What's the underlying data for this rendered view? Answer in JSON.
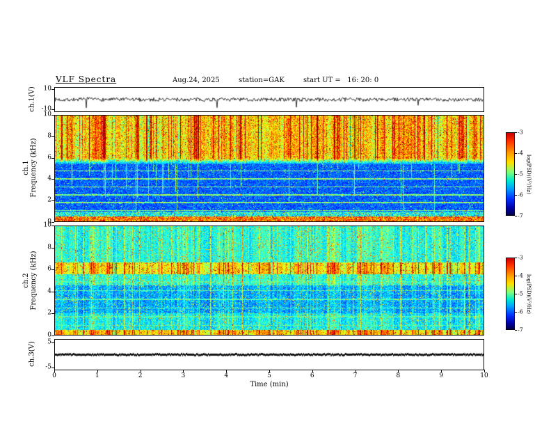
{
  "header": {
    "title": "VLF Spectra",
    "date": "Aug.24, 2025",
    "station": "station=GAK",
    "start_ut": "start UT =   16: 20: 0"
  },
  "xaxis": {
    "label": "Time (min)",
    "ticks": [
      "0",
      "1",
      "2",
      "3",
      "4",
      "5",
      "6",
      "7",
      "8",
      "9",
      "10"
    ],
    "range": [
      0,
      10
    ]
  },
  "panels": {
    "wave1": {
      "ylabel": "ch.1(V)",
      "yticks": [
        "10",
        "-10"
      ],
      "ylim": [
        -10,
        10
      ]
    },
    "spec1": {
      "channel": "ch.1",
      "ylabel": "Frequency (kHz)",
      "yticks": [
        "10",
        "8",
        "6",
        "4",
        "2",
        "0"
      ],
      "ylim": [
        0,
        10
      ]
    },
    "spec2": {
      "channel": "ch.2",
      "ylabel": "Frequency (kHz)",
      "yticks": [
        "10",
        "8",
        "6",
        "4",
        "2",
        "0"
      ],
      "ylim": [
        0,
        10
      ]
    },
    "wave3": {
      "ylabel": "ch.3(V)",
      "yticks": [
        "5",
        "-5"
      ],
      "ylim": [
        -5,
        5
      ]
    }
  },
  "colorbar": {
    "label": "log(PSD)(V²/Hz)",
    "ticks": [
      "-3",
      "-4",
      "-5",
      "-6",
      "-7"
    ],
    "scale_range": [
      -7,
      -3
    ]
  },
  "chart_data": [
    {
      "type": "line",
      "name": "ch.1(V) time series",
      "xlabel": "Time (min)",
      "xlim": [
        0,
        10
      ],
      "ylabel": "ch.1(V)",
      "ylim": [
        -10,
        10
      ],
      "description": "Broadband receiver output fluctuating around 0 V (roughly ±2 V) with intermittent impulsive spikes reaching about ±8 V throughout the 10-minute record."
    },
    {
      "type": "heatmap",
      "name": "ch.1 spectrogram",
      "xlabel": "Time (min)",
      "xlim": [
        0,
        10
      ],
      "ylabel": "Frequency (kHz)",
      "ylim": [
        0,
        10
      ],
      "colorbar_label": "log(PSD)(V²/Hz)",
      "color_scale": [
        -7,
        -3
      ],
      "colormap": "jet",
      "description": "Dense vertical impulsive striations (sferics) strongest above ~6 kHz (green/yellow/red, log PSD ≈ -4 to -3); 0.5–5.5 kHz mostly dark blue background (≈ -6.5 to -7) crossed by thin cyan horizontal tone lines and occasional full-height streaks; bright red-orange band below ~0.5 kHz."
    },
    {
      "type": "heatmap",
      "name": "ch.2 spectrogram",
      "xlabel": "Time (min)",
      "xlim": [
        0,
        10
      ],
      "ylabel": "Frequency (kHz)",
      "ylim": [
        0,
        10
      ],
      "colorbar_label": "log(PSD)(V²/Hz)",
      "color_scale": [
        -7,
        -3
      ],
      "colormap": "jet",
      "description": "Similar vertical sferic striations over a brighter cyan-green background; persistent yellow-green band near 6 kHz; darker blue region 2–4.5 kHz with thin cyan horizontal lines; bright band below ~0.5 kHz."
    },
    {
      "type": "line",
      "name": "ch.3(V) time series",
      "xlabel": "Time (min)",
      "xlim": [
        0,
        10
      ],
      "ylabel": "ch.3(V)",
      "ylim": [
        -5,
        5
      ],
      "description": "Essentially constant level at ~0 V forming a flat dark trace for the entire record."
    }
  ]
}
